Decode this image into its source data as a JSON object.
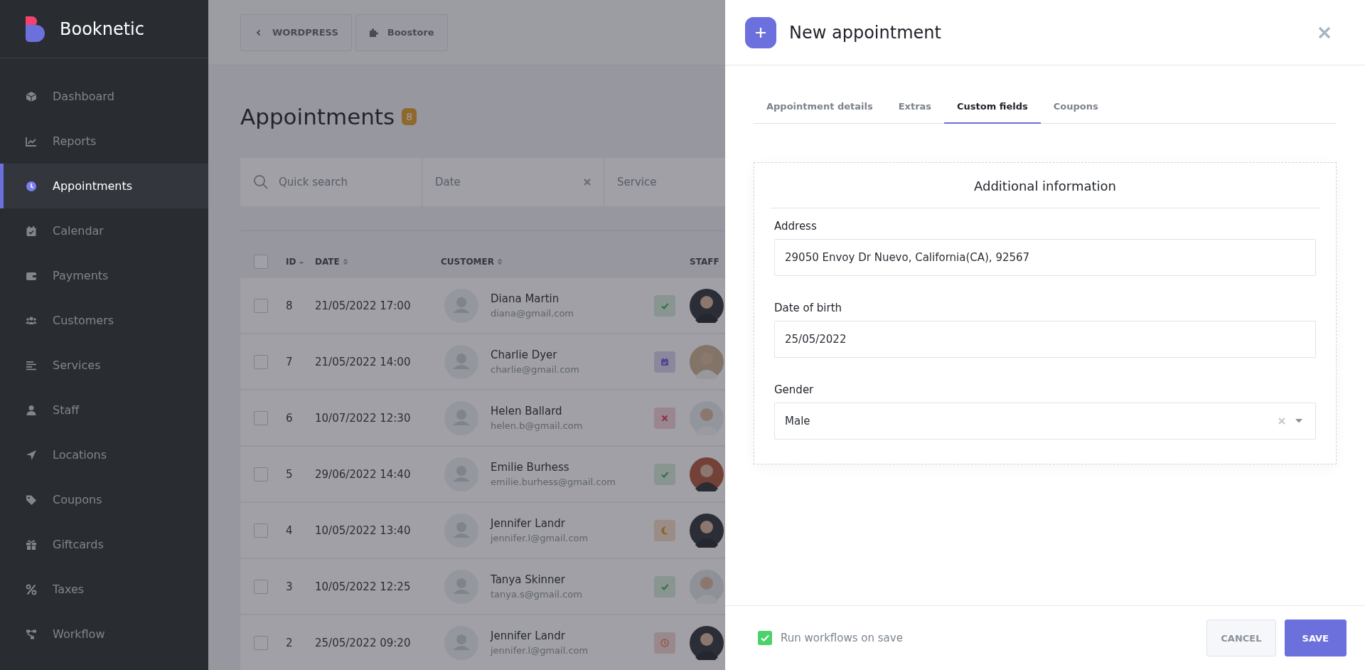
{
  "brand": {
    "name": "Booknetic"
  },
  "sidebar": {
    "items": [
      {
        "label": "Dashboard",
        "kind": "cube",
        "selected": false
      },
      {
        "label": "Reports",
        "kind": "chart",
        "selected": false
      },
      {
        "label": "Appointments",
        "kind": "clock",
        "selected": true
      },
      {
        "label": "Calendar",
        "kind": "calendar",
        "selected": false
      },
      {
        "label": "Payments",
        "kind": "wallet",
        "selected": false
      },
      {
        "label": "Customers",
        "kind": "users",
        "selected": false
      },
      {
        "label": "Services",
        "kind": "lines",
        "selected": false
      },
      {
        "label": "Staff",
        "kind": "user",
        "selected": false
      },
      {
        "label": "Locations",
        "kind": "arrow",
        "selected": false
      },
      {
        "label": "Coupons",
        "kind": "tag",
        "selected": false
      },
      {
        "label": "Giftcards",
        "kind": "gift",
        "selected": false
      },
      {
        "label": "Taxes",
        "kind": "percent",
        "selected": false
      },
      {
        "label": "Workflow",
        "kind": "flow",
        "selected": false
      }
    ]
  },
  "topbar": {
    "buttons": [
      {
        "label": "WORDPRESS",
        "kind": "back"
      },
      {
        "label": "Boostore",
        "kind": "puzzle"
      }
    ]
  },
  "page": {
    "title": "Appointments",
    "count": "8"
  },
  "filters": {
    "search": {
      "placeholder": "Quick search"
    },
    "date": {
      "placeholder": "Date"
    },
    "service": {
      "placeholder": "Service"
    }
  },
  "table": {
    "all_checked": false,
    "columns": [
      {
        "label": "ID",
        "kind": "sorted"
      },
      {
        "label": "DATE",
        "kind": "sortable"
      },
      {
        "label": "CUSTOMER",
        "kind": "sortable"
      },
      {
        "label": "STAFF",
        "kind": "plain"
      }
    ],
    "rows": [
      {
        "id": "8",
        "date": "21/05/2022 17:00",
        "customer": "Diana Martin",
        "email": "diana@gmail.com",
        "kind": "approved",
        "checked": false
      },
      {
        "id": "7",
        "date": "21/05/2022 14:00",
        "customer": "Charlie Dyer",
        "email": "charlie@gmail.com",
        "kind": "scheduled",
        "checked": false
      },
      {
        "id": "6",
        "date": "10/07/2022 12:30",
        "customer": "Helen Ballard",
        "email": "helen.b@gmail.com",
        "kind": "canceled",
        "checked": false
      },
      {
        "id": "5",
        "date": "29/06/2022 14:40",
        "customer": "Emilie Burhess",
        "email": "emilie.burhess@gmail.com",
        "kind": "approved",
        "checked": false
      },
      {
        "id": "4",
        "date": "10/05/2022 13:40",
        "customer": "Jennifer Landr",
        "email": "jennifer.l@gmail.com",
        "kind": "waiting",
        "checked": false
      },
      {
        "id": "3",
        "date": "10/05/2022 12:25",
        "customer": "Tanya Skinner",
        "email": "tanya.s@gmail.com",
        "kind": "approved",
        "checked": false
      },
      {
        "id": "2",
        "date": "25/05/2022 09:20",
        "customer": "Jennifer Landr",
        "email": "jennifer.l@gmail.com",
        "kind": "pending",
        "checked": false
      }
    ]
  },
  "panel": {
    "title": "New appointment",
    "tabs": [
      {
        "label": "Appointment details",
        "selected": false
      },
      {
        "label": "Extras",
        "selected": false
      },
      {
        "label": "Custom fields",
        "selected": true
      },
      {
        "label": "Coupons",
        "selected": false
      }
    ],
    "section_title": "Additional information",
    "fields": [
      {
        "label": "Address",
        "value": "29050 Envoy Dr Nuevo, California(CA), 92567",
        "kind": "text"
      },
      {
        "label": "Date of birth",
        "value": "25/05/2022",
        "kind": "text"
      },
      {
        "label": "Gender",
        "value": "Male",
        "kind": "select"
      }
    ],
    "footer": {
      "workflow": {
        "label": "Run workflows on save",
        "checked": true
      },
      "buttons": [
        {
          "label": "CANCEL",
          "kind": "secondary"
        },
        {
          "label": "SAVE",
          "kind": "primary"
        }
      ]
    }
  }
}
